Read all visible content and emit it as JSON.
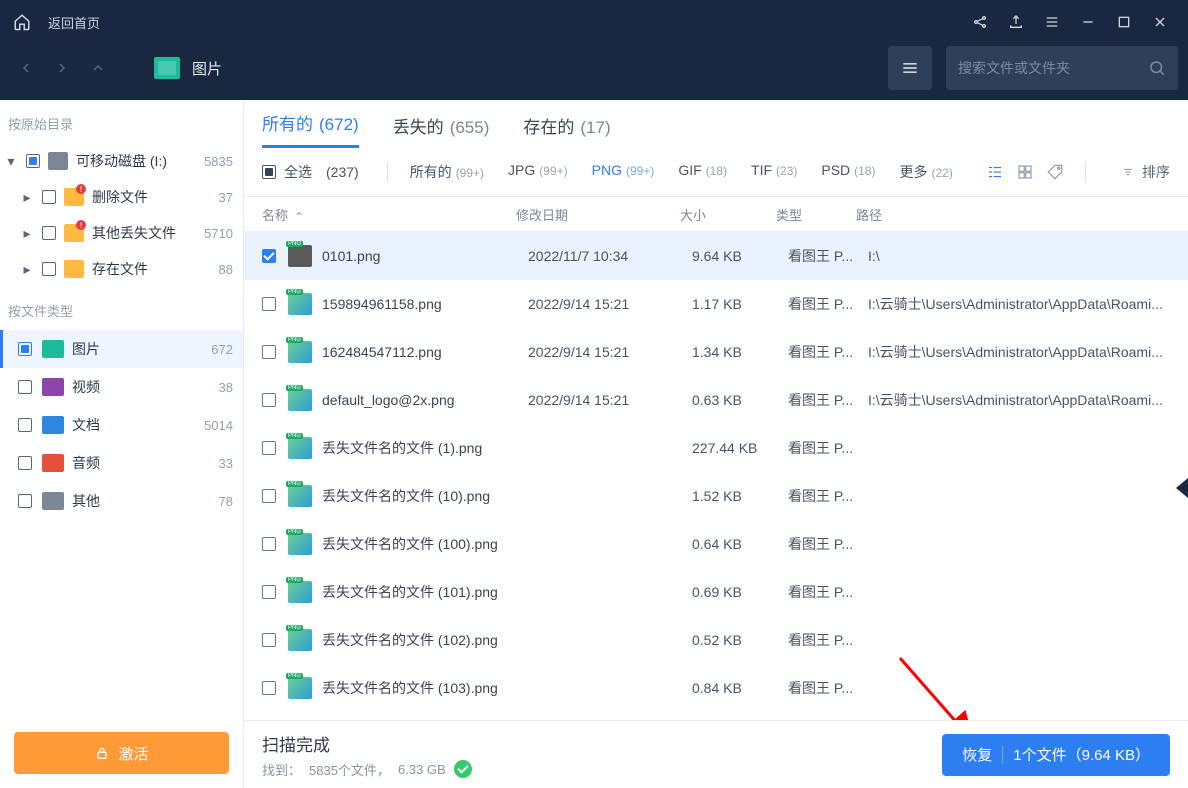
{
  "titlebar": {
    "back_home": "返回首页"
  },
  "navbar": {
    "crumb": "图片",
    "search_placeholder": "搜索文件或文件夹"
  },
  "sidebar": {
    "section1_label": "按原始目录",
    "tree": {
      "root": {
        "label": "可移动磁盘 (I:)",
        "count": "5835"
      },
      "children": [
        {
          "label": "删除文件",
          "count": "37"
        },
        {
          "label": "其他丢失文件",
          "count": "5710"
        },
        {
          "label": "存在文件",
          "count": "88"
        }
      ]
    },
    "section2_label": "按文件类型",
    "categories": [
      {
        "label": "图片",
        "count": "672",
        "color": "#1abc9c"
      },
      {
        "label": "视频",
        "count": "38",
        "color": "#8e44ad"
      },
      {
        "label": "文档",
        "count": "5014",
        "color": "#2e86de"
      },
      {
        "label": "音频",
        "count": "33",
        "color": "#e55039"
      },
      {
        "label": "其他",
        "count": "78",
        "color": "#7d8896"
      }
    ],
    "activate": "激活"
  },
  "status_tabs": [
    {
      "label": "所有的",
      "count": "(672)"
    },
    {
      "label": "丢失的",
      "count": "(655)"
    },
    {
      "label": "存在的",
      "count": "(17)"
    }
  ],
  "filters": {
    "select_all": "全选",
    "select_all_count": "(237)",
    "chips": [
      {
        "label": "所有的",
        "sub": "(99+)"
      },
      {
        "label": "JPG",
        "sub": "(99+)"
      },
      {
        "label": "PNG",
        "sub": "(99+)"
      },
      {
        "label": "GIF",
        "sub": "(18)"
      },
      {
        "label": "TIF",
        "sub": "(23)"
      },
      {
        "label": "PSD",
        "sub": "(18)"
      },
      {
        "label": "更多",
        "sub": "(22)"
      }
    ],
    "sort_label": "排序"
  },
  "columns": {
    "name": "名称",
    "date": "修改日期",
    "size": "大小",
    "type": "类型",
    "path": "路径"
  },
  "rows": [
    {
      "name": "0101.png",
      "date": "2022/11/7 10:34",
      "size": "9.64 KB",
      "type": "看图王 P...",
      "path": "I:\\",
      "selected": true,
      "photo": true
    },
    {
      "name": "159894961158.png",
      "date": "2022/9/14 15:21",
      "size": "1.17 KB",
      "type": "看图王 P...",
      "path": "I:\\云骑士\\Users\\Administrator\\AppData\\Roami..."
    },
    {
      "name": "162484547112.png",
      "date": "2022/9/14 15:21",
      "size": "1.34 KB",
      "type": "看图王 P...",
      "path": "I:\\云骑士\\Users\\Administrator\\AppData\\Roami..."
    },
    {
      "name": "default_logo@2x.png",
      "date": "2022/9/14 15:21",
      "size": "0.63 KB",
      "type": "看图王 P...",
      "path": "I:\\云骑士\\Users\\Administrator\\AppData\\Roami..."
    },
    {
      "name": "丢失文件名的文件 (1).png",
      "date": "",
      "size": "227.44 KB",
      "type": "看图王 P...",
      "path": ""
    },
    {
      "name": "丢失文件名的文件 (10).png",
      "date": "",
      "size": "1.52 KB",
      "type": "看图王 P...",
      "path": ""
    },
    {
      "name": "丢失文件名的文件 (100).png",
      "date": "",
      "size": "0.64 KB",
      "type": "看图王 P...",
      "path": ""
    },
    {
      "name": "丢失文件名的文件 (101).png",
      "date": "",
      "size": "0.69 KB",
      "type": "看图王 P...",
      "path": ""
    },
    {
      "name": "丢失文件名的文件 (102).png",
      "date": "",
      "size": "0.52 KB",
      "type": "看图王 P...",
      "path": ""
    },
    {
      "name": "丢失文件名的文件 (103).png",
      "date": "",
      "size": "0.84 KB",
      "type": "看图王 P...",
      "path": ""
    }
  ],
  "footer": {
    "title": "扫描完成",
    "found_prefix": "找到：",
    "found_files": "5835个文件，",
    "found_size": "6.33 GB",
    "recover": "恢复",
    "recover_info": "1个文件（9.64 KB）"
  }
}
